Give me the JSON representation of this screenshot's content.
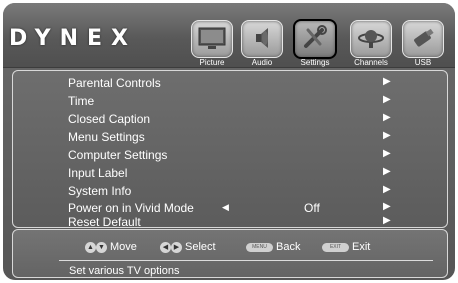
{
  "brand": "DYNEX",
  "tabs": [
    {
      "label": "Picture",
      "icon": "picture-tv-icon",
      "selected": false
    },
    {
      "label": "Audio",
      "icon": "audio-speaker-icon",
      "selected": false
    },
    {
      "label": "Settings",
      "icon": "settings-wrench-icon",
      "selected": true
    },
    {
      "label": "Channels",
      "icon": "channels-satellite-icon",
      "selected": false
    },
    {
      "label": "USB",
      "icon": "usb-drive-icon",
      "selected": false
    }
  ],
  "menu": {
    "items": [
      {
        "label": "Parental Controls"
      },
      {
        "label": "Time"
      },
      {
        "label": "Closed Caption"
      },
      {
        "label": "Menu Settings"
      },
      {
        "label": "Computer Settings"
      },
      {
        "label": "Input Label"
      },
      {
        "label": "System Info"
      },
      {
        "label": "Power on in Vivid Mode",
        "value": "Off"
      },
      {
        "label": "Reset Default"
      }
    ],
    "chevron": "▶",
    "left_arrow": "◀"
  },
  "footer": {
    "move": "Move",
    "select": "Select",
    "back": "Back",
    "exit": "Exit",
    "menu_key": "MENU",
    "exit_key": "EXIT",
    "status": "Set various TV options"
  },
  "colors": {
    "selected_border": "#000000",
    "text": "#ffffff"
  }
}
